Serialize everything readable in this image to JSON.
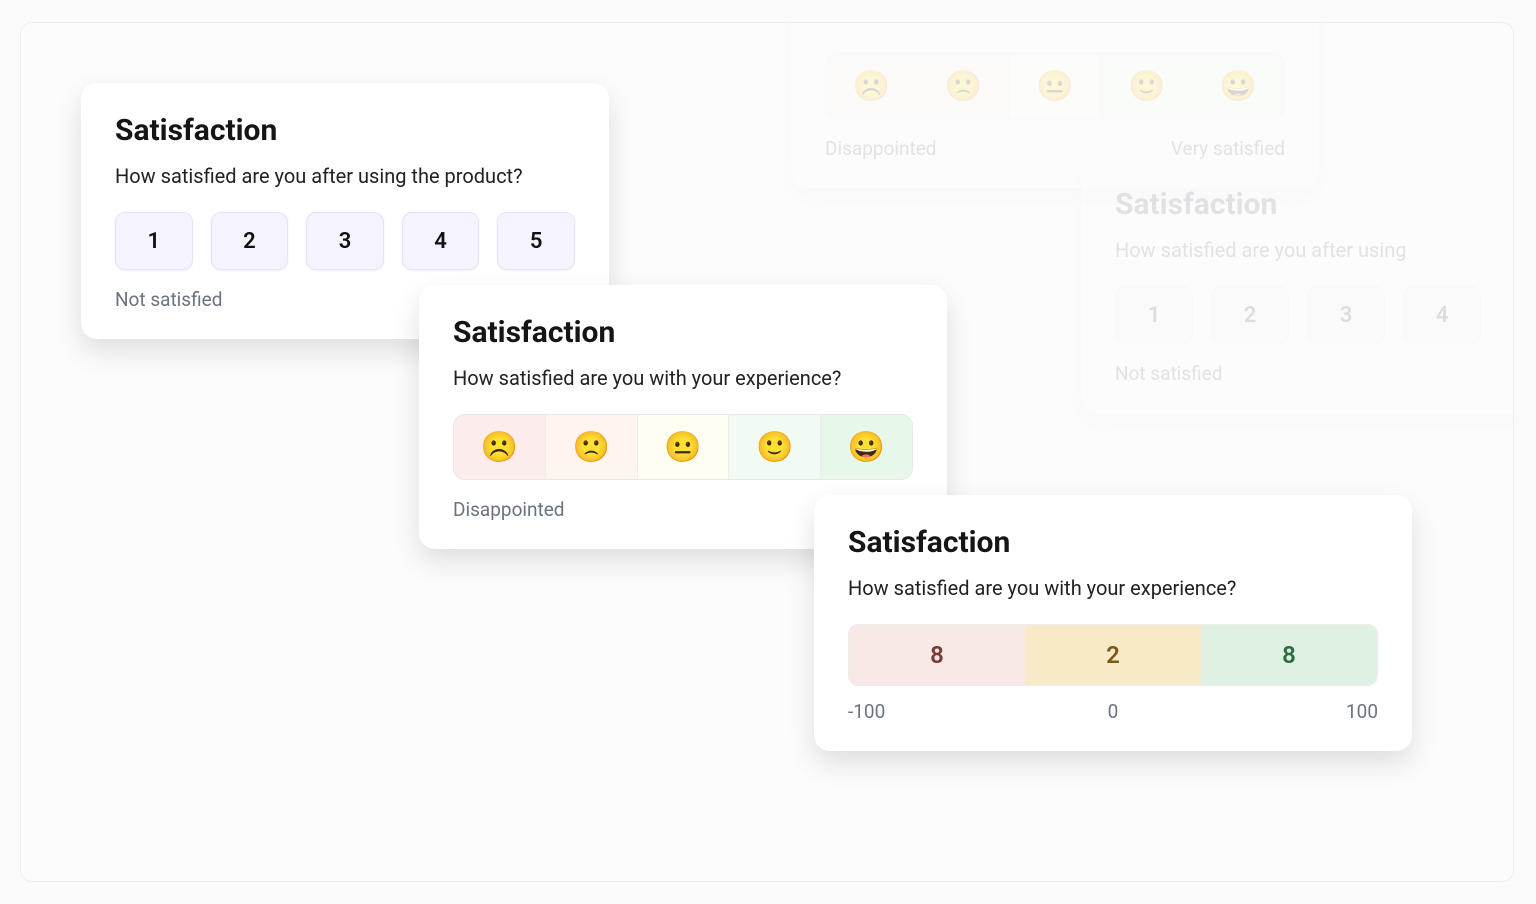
{
  "cards": {
    "numeric": {
      "title": "Satisfaction",
      "question": "How satisfied are you after using the product?",
      "options": [
        "1",
        "2",
        "3",
        "4",
        "5"
      ],
      "caption_left": "Not satisfied"
    },
    "emoji": {
      "title": "Satisfaction",
      "question": "How satisfied are you with your experience?",
      "emojis": [
        "☹️",
        "🙁",
        "😐",
        "🙂",
        "😀"
      ],
      "caption_left": "Disappointed",
      "caption_right": "Very satisfied"
    },
    "nps": {
      "title": "Satisfaction",
      "question": "How satisfied are you with your experience?",
      "segments": [
        "8",
        "2",
        "8"
      ],
      "labels": {
        "left": "-100",
        "mid": "0",
        "right": "100"
      }
    },
    "bg_numeric": {
      "title": "Satisfaction",
      "question": "How satisfied are you after using",
      "options": [
        "1",
        "2",
        "3",
        "4"
      ],
      "caption_left": "Not satisfied"
    }
  }
}
